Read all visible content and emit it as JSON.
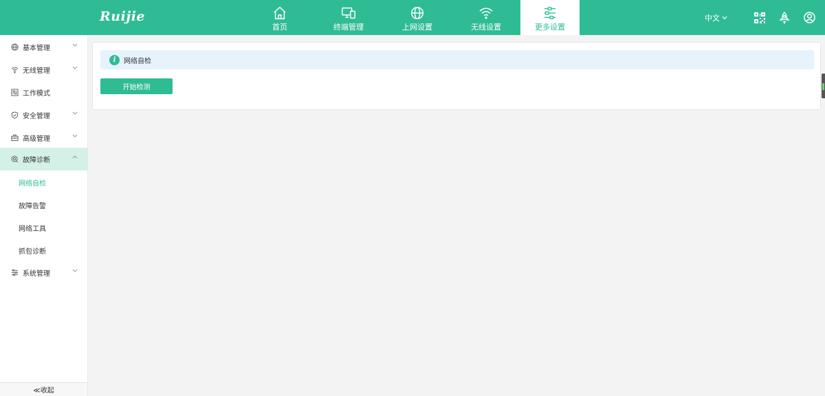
{
  "app": {
    "logo": "Ruijie"
  },
  "nav": [
    {
      "label": "首页",
      "icon": "home-icon"
    },
    {
      "label": "终端管理",
      "icon": "devices-icon"
    },
    {
      "label": "上网设置",
      "icon": "globe-icon"
    },
    {
      "label": "无线设置",
      "icon": "wifi-icon"
    },
    {
      "label": "更多设置",
      "icon": "settings-sliders-icon",
      "active": true
    }
  ],
  "header_tools": {
    "language": "中文"
  },
  "sidebar": {
    "items": [
      {
        "label": "基本管理",
        "icon": "globe-icon"
      },
      {
        "label": "无线管理",
        "icon": "wifi-icon"
      },
      {
        "label": "工作模式",
        "icon": "mode-icon"
      },
      {
        "label": "安全管理",
        "icon": "shield-icon"
      },
      {
        "label": "高级管理",
        "icon": "toolbox-icon"
      },
      {
        "label": "故障诊断",
        "icon": "diagnose-icon",
        "open": true
      },
      {
        "label": "系统管理",
        "icon": "sliders-icon"
      }
    ],
    "sub_items": [
      {
        "label": "网络自检",
        "active": true
      },
      {
        "label": "故障告警"
      },
      {
        "label": "网络工具"
      },
      {
        "label": "抓包诊断"
      }
    ],
    "collapse_label": "≪收起"
  },
  "main": {
    "info_title": "网络自检",
    "start_button": "开始检测"
  },
  "colors": {
    "accent": "#2fbc95",
    "info_bg": "#e6f3fd",
    "open_bg": "#d4f1e7"
  }
}
